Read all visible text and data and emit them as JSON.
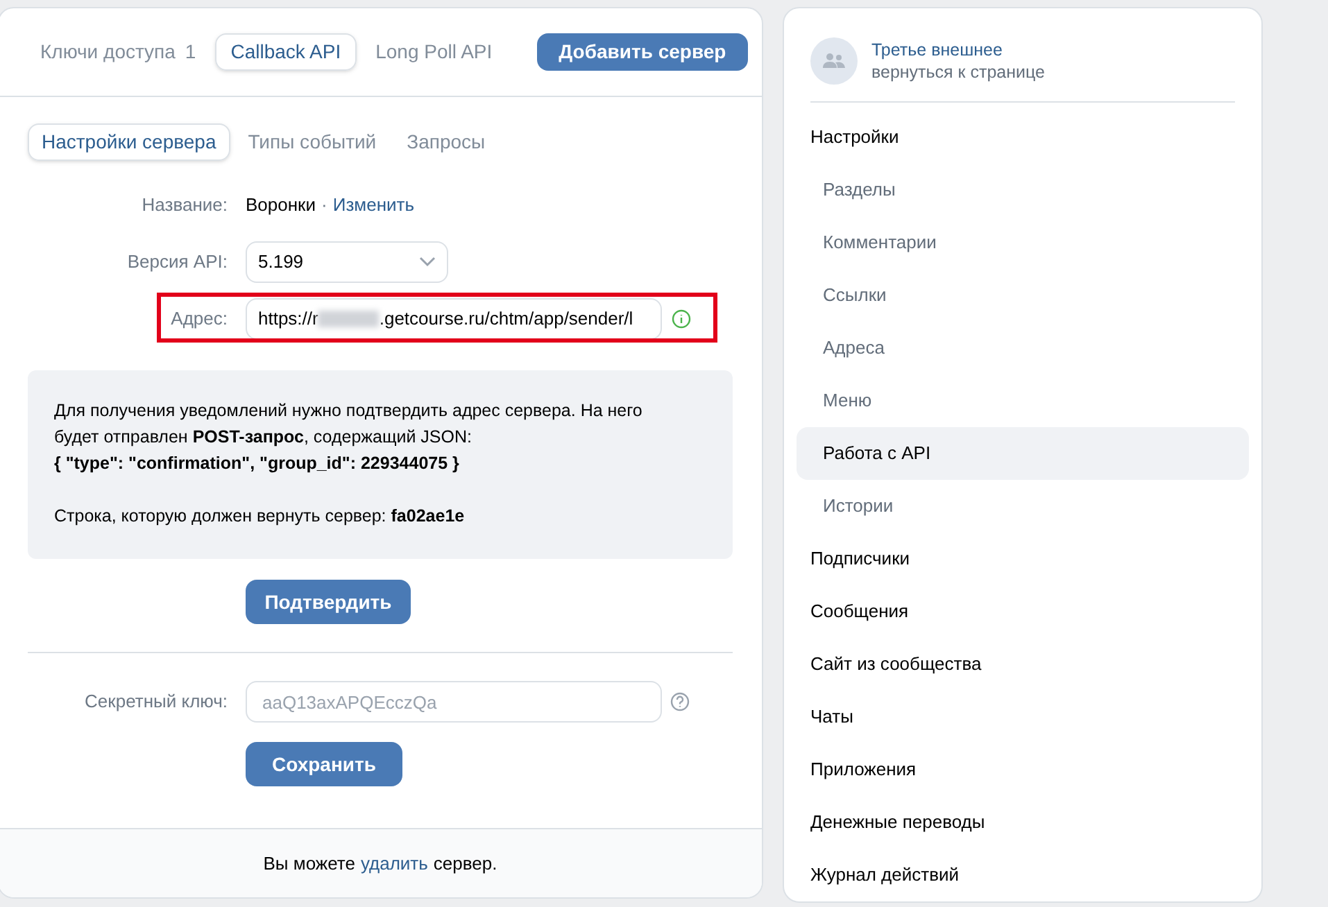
{
  "top_tabs": [
    {
      "label": "Ключи доступа",
      "count": "1",
      "selected": false
    },
    {
      "label": "Callback API",
      "selected": true
    },
    {
      "label": "Long Poll API",
      "selected": false
    }
  ],
  "add_server_button": "Добавить сервер",
  "sub_tabs": [
    {
      "label": "Настройки сервера",
      "selected": true
    },
    {
      "label": "Типы событий",
      "selected": false
    },
    {
      "label": "Запросы",
      "selected": false
    }
  ],
  "name_row": {
    "label": "Название:",
    "value": "Воронки",
    "separator": "·",
    "link": "Изменить"
  },
  "api_version": {
    "label": "Версия API:",
    "value": "5.199"
  },
  "address": {
    "label": "Адрес:",
    "value_start": "https://r",
    "value_end": ".getcourse.ru/chtm/app/sender/l",
    "highlighted": true,
    "verified": true
  },
  "info_box": {
    "paragraph": "Для получения уведомлений нужно подтвердить адрес сервера. На него будет отправлен **POST-запрос**, содержащий JSON:",
    "json_line": "{ \"type\": \"confirmation\", \"group_id\": 229344075 }",
    "answer_line": "Строка, которую должен вернуть сервер: **fa02ae1e**"
  },
  "confirm_button": "Подтвердить",
  "secret_key": {
    "label": "Секретный ключ:",
    "placeholder": "aaQ13axAPQEcczQa"
  },
  "save_button": "Сохранить",
  "footer": {
    "before": "Вы можете",
    "link": "удалить",
    "after": "сервер."
  },
  "community": {
    "name": "Третье внешнее",
    "back_link": "вернуться к странице"
  },
  "sidebar": [
    {
      "label": "Настройки",
      "selected": false,
      "children": [
        {
          "label": "Разделы",
          "selected": false
        },
        {
          "label": "Комментарии",
          "selected": false
        },
        {
          "label": "Ссылки",
          "selected": false
        },
        {
          "label": "Адреса",
          "selected": false
        },
        {
          "label": "Меню",
          "selected": false
        },
        {
          "label": "Работа с API",
          "selected": true
        },
        {
          "label": "Истории",
          "selected": false
        }
      ]
    },
    {
      "label": "Подписчики",
      "selected": false
    },
    {
      "label": "Сообщения",
      "selected": false
    },
    {
      "label": "Сайт из сообщества",
      "selected": false
    },
    {
      "label": "Чаты",
      "selected": false
    },
    {
      "label": "Приложения",
      "selected": false
    },
    {
      "label": "Денежные переводы",
      "selected": false
    },
    {
      "label": "Журнал действий",
      "selected": false
    }
  ]
}
